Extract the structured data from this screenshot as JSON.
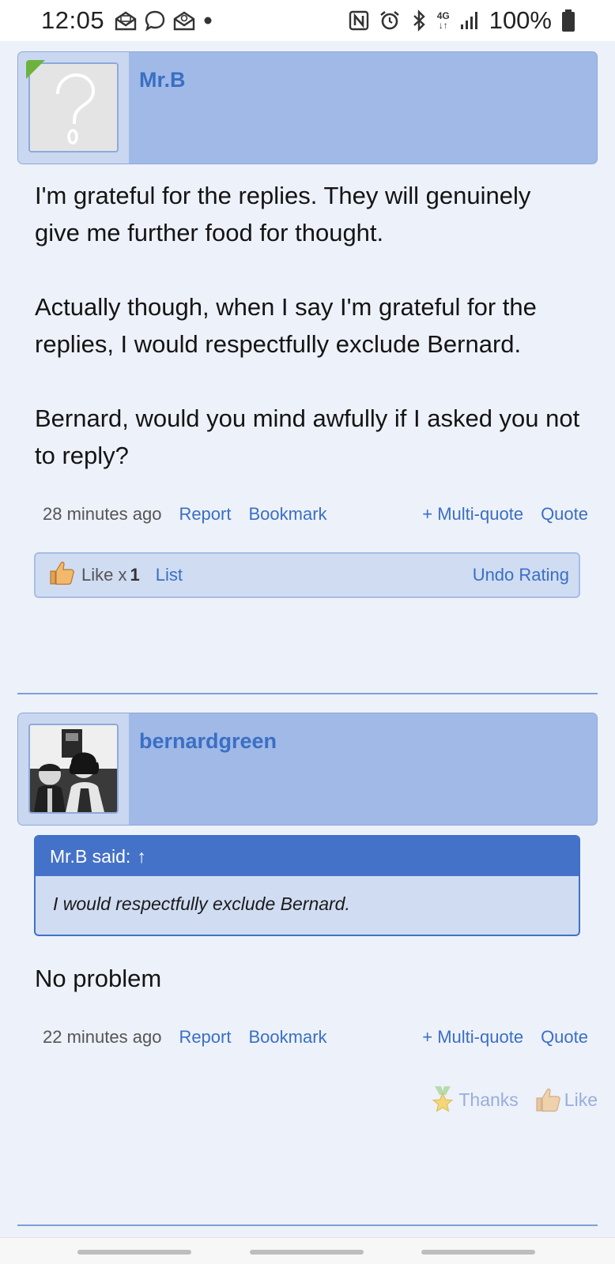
{
  "status_bar": {
    "time": "12:05",
    "battery_text": "100%",
    "network_label": "4G",
    "left_icons": [
      "email-open-icon",
      "chat-bubble-icon",
      "email-open-icon",
      "notification-dot-icon"
    ],
    "right_icons": [
      "nfc-icon",
      "alarm-icon",
      "bluetooth-icon",
      "4g-data-icon",
      "signal-bars-icon",
      "battery-icon"
    ]
  },
  "posts": [
    {
      "username": "Mr.B",
      "avatar": "question-mark-placeholder",
      "body": [
        "I'm grateful for the replies. They will genuinely give me further food for thought.",
        "Actually though, when I say I'm grateful for the replies, I would respectfully exclude Bernard.",
        "Bernard, would you mind awfully if I asked you not to reply?"
      ],
      "time": "28 minutes ago",
      "actions": {
        "report": "Report",
        "bookmark": "Bookmark",
        "multiquote": "+ Multi-quote",
        "quote": "Quote"
      },
      "likes": {
        "label": "Like x",
        "count": "1",
        "list": "List",
        "undo": "Undo Rating"
      }
    },
    {
      "username": "bernardgreen",
      "avatar": "black-and-white-photo",
      "quote": {
        "header": "Mr.B said:",
        "arrow": "↑",
        "text": "I would respectfully exclude Bernard."
      },
      "body": [
        "No problem"
      ],
      "time": "22 minutes ago",
      "actions": {
        "report": "Report",
        "bookmark": "Bookmark",
        "multiquote": "+ Multi-quote",
        "quote": "Quote"
      },
      "reactions": {
        "thanks": "Thanks",
        "like": "Like"
      }
    }
  ],
  "colors": {
    "accent": "#3a6fc4",
    "header_bg": "#a0b9e6",
    "page_bg": "#edf1f9",
    "quote_header": "#4472c8",
    "online": "#6cb33e"
  }
}
